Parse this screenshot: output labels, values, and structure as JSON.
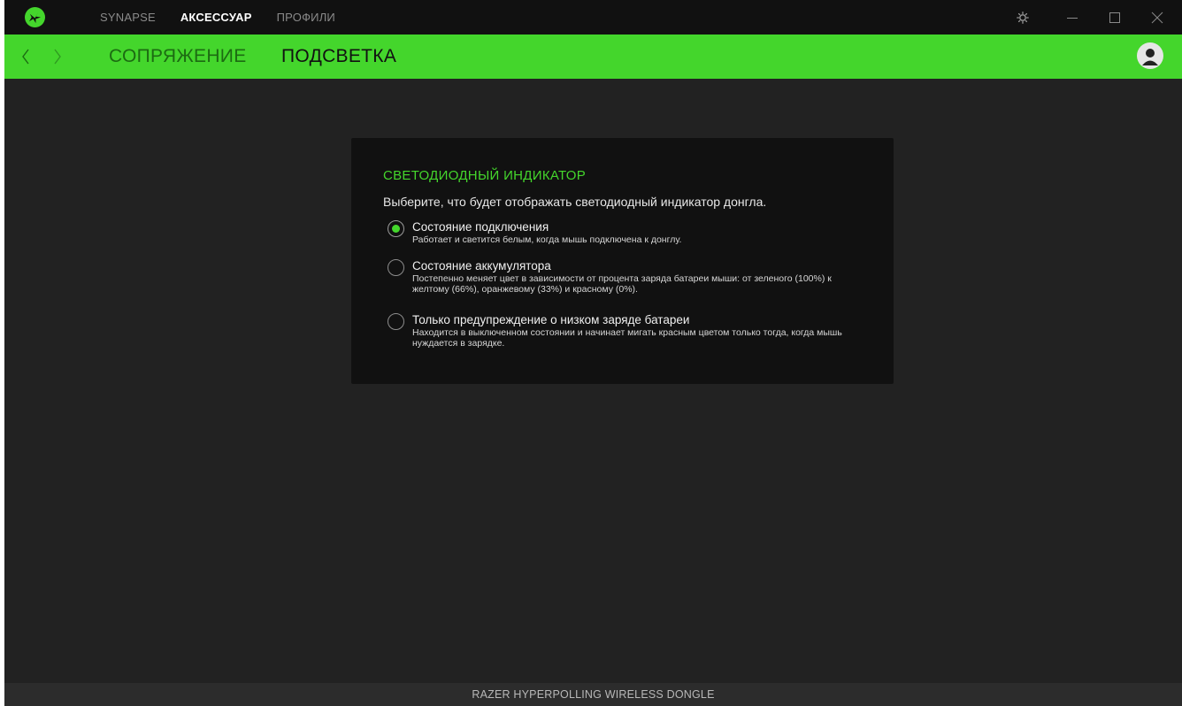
{
  "window": {
    "tabs": [
      {
        "label": "SYNAPSE",
        "active": false
      },
      {
        "label": "АКСЕССУАР",
        "active": true
      },
      {
        "label": "ПРОФИЛИ",
        "active": false
      }
    ],
    "controls": [
      "settings-icon",
      "minimize-icon",
      "maximize-icon",
      "close-icon"
    ]
  },
  "subheader": {
    "tabs": [
      {
        "label": "СОПРЯЖЕНИЕ",
        "active": false
      },
      {
        "label": "ПОДСВЕТКА",
        "active": true
      }
    ]
  },
  "led_card": {
    "title": "СВЕТОДИОДНЫЙ ИНДИКАТОР",
    "description": "Выберите, что будет отображать светодиодный индикатор донгла.",
    "options": [
      {
        "label": "Состояние подключения",
        "description": "Работает и светится белым, когда мышь подключена к донглу.",
        "selected": true
      },
      {
        "label": "Состояние аккумулятора",
        "description": "Постепенно меняет цвет в зависимости от процента заряда батареи мыши: от зеленого (100%) к желтому (66%), оранжевому (33%) и красному (0%).",
        "selected": false
      },
      {
        "label": "Только предупреждение о низком заряде батареи",
        "description": "Находится в выключенном состоянии и начинает мигать красным цветом только тогда, когда мышь нуждается в зарядке.",
        "selected": false
      }
    ]
  },
  "statusbar": {
    "device_name": "RAZER HYPERPOLLING WIRELESS DONGLE"
  },
  "colors": {
    "accent": "#44d62c",
    "background": "#222222",
    "titlebar": "#111111",
    "card": "#111111"
  }
}
